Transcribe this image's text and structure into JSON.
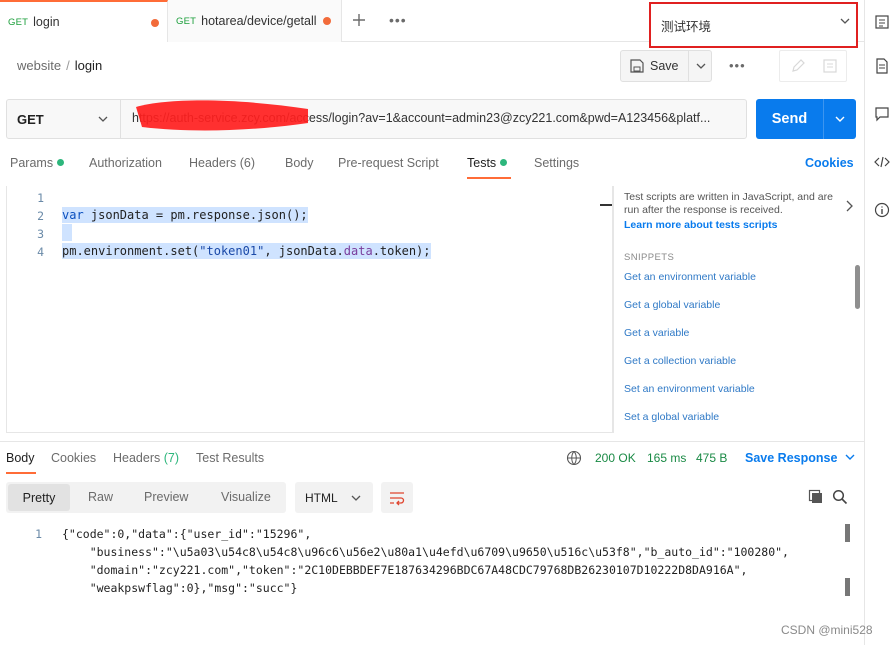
{
  "tabs": [
    {
      "method": "GET",
      "label": "login"
    },
    {
      "method": "GET",
      "label": "hotarea/device/getall"
    }
  ],
  "environment": {
    "selected": "测试环境"
  },
  "breadcrumb": {
    "collection": "website",
    "separator": "/",
    "request": "login"
  },
  "toolbar": {
    "save_label": "Save",
    "more": "•••"
  },
  "request": {
    "method": "GET",
    "url": "https://auth-service.zcy.com/access/login?av=1&account=admin23@zcy221.com&pwd=A123456&platf...",
    "send_label": "Send"
  },
  "request_tabs": [
    {
      "label": "Params",
      "dot": true
    },
    {
      "label": "Authorization",
      "dot": false
    },
    {
      "label": "Headers (6)",
      "dot": false
    },
    {
      "label": "Body",
      "dot": false
    },
    {
      "label": "Pre-request Script",
      "dot": false
    },
    {
      "label": "Tests",
      "dot": true
    },
    {
      "label": "Settings",
      "dot": false
    }
  ],
  "cookies_label": "Cookies",
  "editor": {
    "line_numbers": [
      "1",
      "2",
      "3",
      "4"
    ]
  },
  "snippets": {
    "description": "Test scripts are written in JavaScript, and are run after the response is received.",
    "learn_more": "Learn more about tests scripts",
    "heading": "SNIPPETS",
    "items": [
      "Get an environment variable",
      "Get a global variable",
      "Get a variable",
      "Get a collection variable",
      "Set an environment variable",
      "Set a global variable"
    ]
  },
  "response": {
    "tabs": [
      {
        "label": "Body"
      },
      {
        "label": "Cookies"
      },
      {
        "label": "Headers",
        "count": "(7)"
      },
      {
        "label": "Test Results"
      }
    ],
    "status": "200 OK",
    "time": "165 ms",
    "size": "475 B",
    "save_response": "Save Response",
    "formats": [
      "Pretty",
      "Raw",
      "Preview",
      "Visualize"
    ],
    "language": "HTML",
    "line_number": "1",
    "body_lines": [
      "{\"code\":0,\"data\":{\"user_id\":\"15296\",",
      "    \"business\":\"\\u5a03\\u54c8\\u54c8\\u96c6\\u56e2\\u80a1\\u4efd\\u6709\\u9650\\u516c\\u53f8\",\"b_auto_id\":\"100280\",",
      "    \"domain\":\"zcy221.com\",\"token\":\"2C10DEBBDEF7E187634296BDC67A48CDC79768DB26230107D10222D8DA916A\",",
      "    \"weakpswflag\":0},\"msg\":\"succ\"}"
    ]
  },
  "watermark": "CSDN @mini528"
}
